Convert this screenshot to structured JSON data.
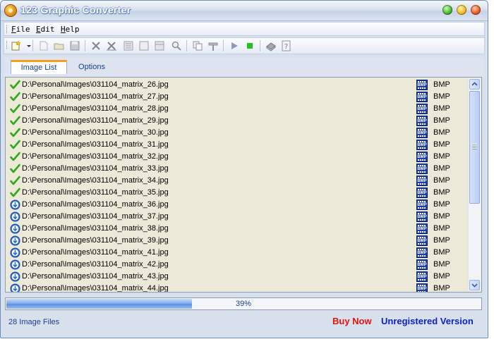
{
  "window": {
    "title": "123 Graphic Converter"
  },
  "menu": {
    "items": [
      "File",
      "Edit",
      "Help"
    ]
  },
  "tabs": [
    {
      "label": "Image List",
      "active": true
    },
    {
      "label": "Options",
      "active": false
    }
  ],
  "list": {
    "rows": [
      {
        "path": "D:\\Personal\\Images\\031104_matrix_26.jpg",
        "format": "BMP",
        "status": "done"
      },
      {
        "path": "D:\\Personal\\Images\\031104_matrix_27.jpg",
        "format": "BMP",
        "status": "done"
      },
      {
        "path": "D:\\Personal\\Images\\031104_matrix_28.jpg",
        "format": "BMP",
        "status": "done"
      },
      {
        "path": "D:\\Personal\\Images\\031104_matrix_29.jpg",
        "format": "BMP",
        "status": "done"
      },
      {
        "path": "D:\\Personal\\Images\\031104_matrix_30.jpg",
        "format": "BMP",
        "status": "done"
      },
      {
        "path": "D:\\Personal\\Images\\031104_matrix_31.jpg",
        "format": "BMP",
        "status": "done"
      },
      {
        "path": "D:\\Personal\\Images\\031104_matrix_32.jpg",
        "format": "BMP",
        "status": "done"
      },
      {
        "path": "D:\\Personal\\Images\\031104_matrix_33.jpg",
        "format": "BMP",
        "status": "done"
      },
      {
        "path": "D:\\Personal\\Images\\031104_matrix_34.jpg",
        "format": "BMP",
        "status": "done"
      },
      {
        "path": "D:\\Personal\\Images\\031104_matrix_35.jpg",
        "format": "BMP",
        "status": "done"
      },
      {
        "path": "D:\\Personal\\Images\\031104_matrix_36.jpg",
        "format": "BMP",
        "status": "pending"
      },
      {
        "path": "D:\\Personal\\Images\\031104_matrix_37.jpg",
        "format": "BMP",
        "status": "pending"
      },
      {
        "path": "D:\\Personal\\Images\\031104_matrix_38.jpg",
        "format": "BMP",
        "status": "pending"
      },
      {
        "path": "D:\\Personal\\Images\\031104_matrix_39.jpg",
        "format": "BMP",
        "status": "pending"
      },
      {
        "path": "D:\\Personal\\Images\\031104_matrix_41.jpg",
        "format": "BMP",
        "status": "pending"
      },
      {
        "path": "D:\\Personal\\Images\\031104_matrix_42.jpg",
        "format": "BMP",
        "status": "pending"
      },
      {
        "path": "D:\\Personal\\Images\\031104_matrix_43.jpg",
        "format": "BMP",
        "status": "pending"
      },
      {
        "path": "D:\\Personal\\Images\\031104_matrix_44.jpg",
        "format": "BMP",
        "status": "pending"
      }
    ],
    "format_icon_text": "BMP"
  },
  "progress": {
    "value": 0.39,
    "label": "39%"
  },
  "status": {
    "files": "28 Image Files",
    "buy": "Buy Now",
    "version": "Unregistered Version"
  },
  "colors": {
    "check": "#2fa81c",
    "pending": "#2a6fd6",
    "buy": "#e81010",
    "version": "#1020c8",
    "play": "#8c9bb3",
    "stop": "#21c21e"
  }
}
